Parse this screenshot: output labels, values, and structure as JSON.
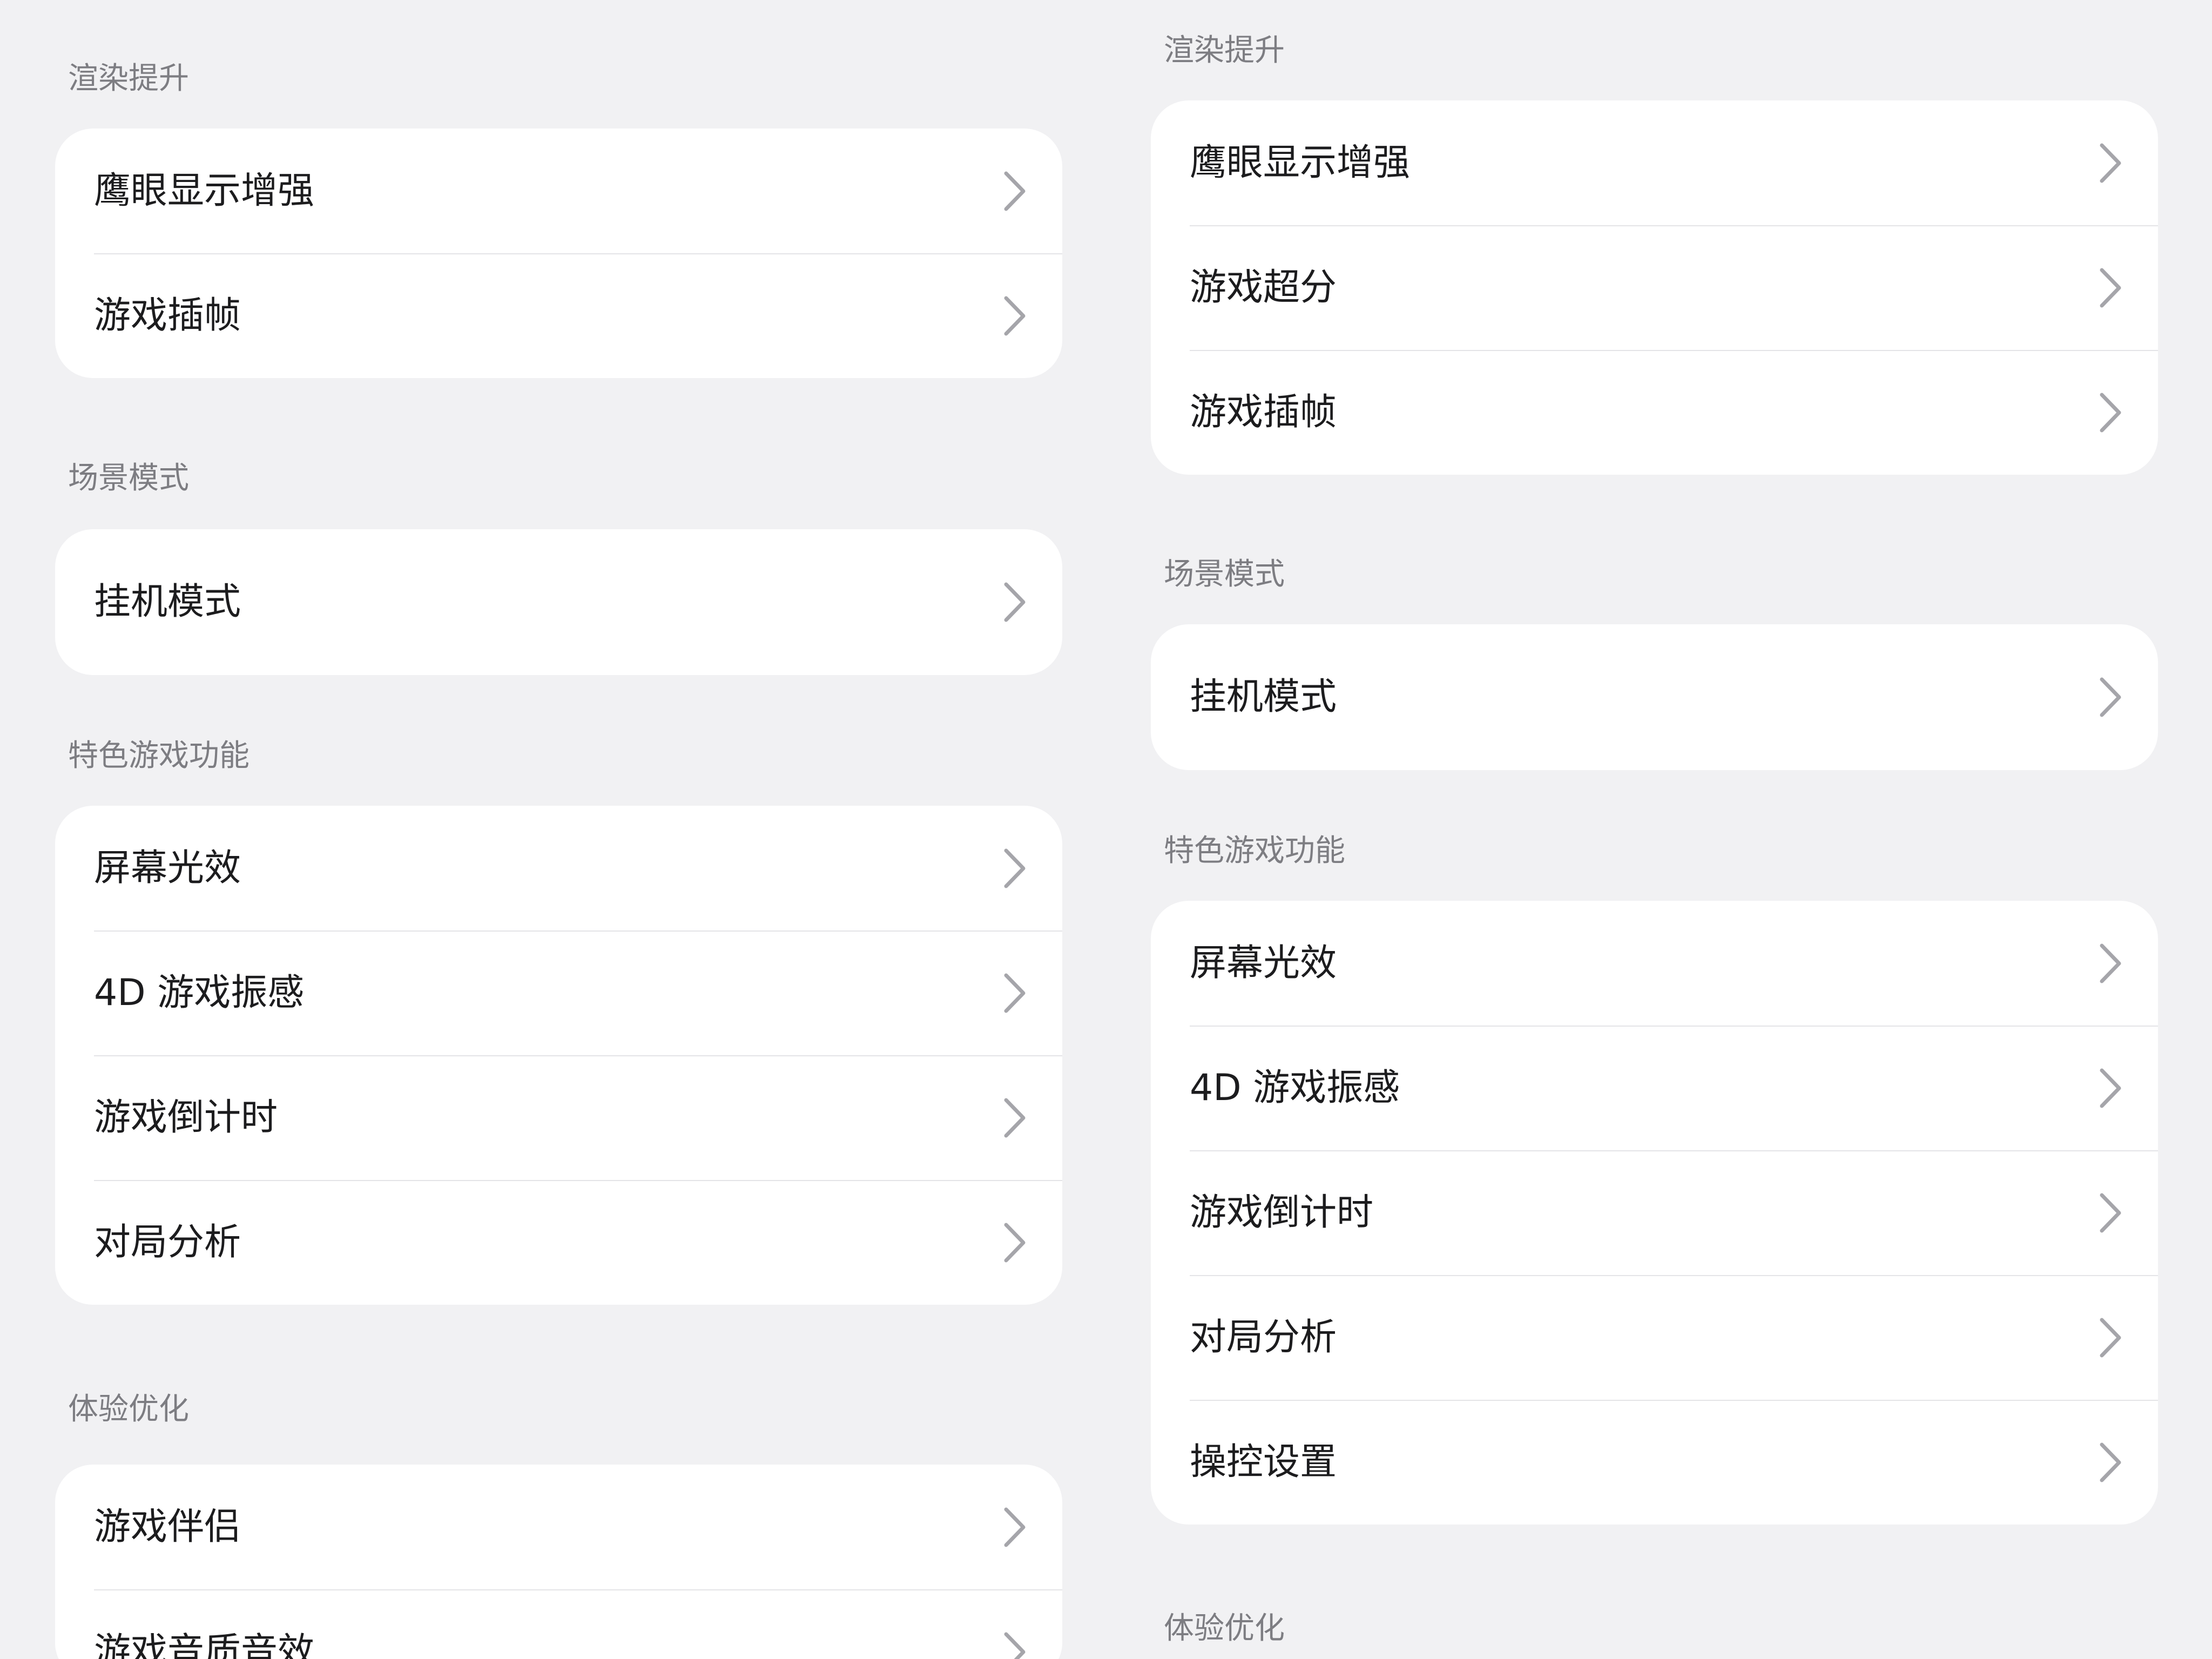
{
  "left": {
    "sections": [
      {
        "title": "渲染提升",
        "items": [
          "鹰眼显示增强",
          "游戏插帧"
        ]
      },
      {
        "title": "场景模式",
        "items": [
          "挂机模式"
        ]
      },
      {
        "title": "特色游戏功能",
        "items": [
          "屏幕光效",
          "4D 游戏振感",
          "游戏倒计时",
          "对局分析"
        ]
      },
      {
        "title": "体验优化",
        "items": [
          "游戏伴侣",
          "游戏音质音效"
        ]
      }
    ]
  },
  "right": {
    "sections": [
      {
        "title": "渲染提升",
        "items": [
          "鹰眼显示增强",
          "游戏超分",
          "游戏插帧"
        ]
      },
      {
        "title": "场景模式",
        "items": [
          "挂机模式"
        ]
      },
      {
        "title": "特色游戏功能",
        "items": [
          "屏幕光效",
          "4D 游戏振感",
          "游戏倒计时",
          "对局分析",
          "操控设置"
        ]
      },
      {
        "title": "体验优化",
        "items": []
      }
    ]
  },
  "icons": {
    "row_chevron": "chevron-right-icon"
  },
  "colors": {
    "background": "#f1f1f3",
    "card": "#ffffff",
    "section_title": "#7d7d82",
    "row_text": "#1c1c1e",
    "chevron": "#a5a5aa",
    "divider": "#e4e4e7"
  }
}
